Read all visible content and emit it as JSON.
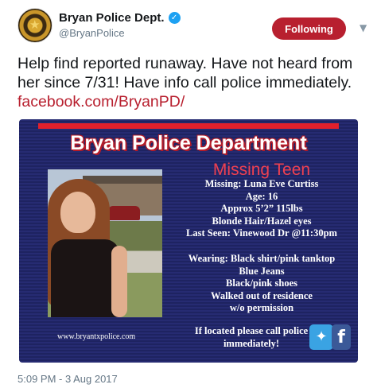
{
  "account": {
    "display_name": "Bryan Police Dept.",
    "handle": "@BryanPolice",
    "verified": true
  },
  "follow_button": {
    "label": "Following"
  },
  "tweet": {
    "text": "Help find reported runaway.  Have not heard from her since 7/31! Have info call police immediately.",
    "link": "facebook.com/BryanPD/",
    "timestamp": "5:09 PM - 3 Aug 2017"
  },
  "flyer": {
    "title": "Bryan Police Department",
    "subtitle": "Missing Teen",
    "details": [
      "Missing: Luna Eve Curtiss",
      "Age: 16",
      "Approx 5’2” 115lbs",
      "Blonde Hair/Hazel eyes",
      "Last Seen: Vinewood Dr  @11:30pm"
    ],
    "wearing": [
      "Wearing:  Black shirt/pink tanktop",
      "Blue Jeans",
      "Black/pink shoes",
      "Walked  out of residence",
      "w/o permission"
    ],
    "call_to_action": [
      "If located please call police",
      "immediately!"
    ],
    "url": "www.bryantxpolice.com"
  },
  "colors": {
    "accent": "#b8202f",
    "verified": "#1da1f2",
    "flyer_background": "#262b72",
    "flyer_title_outline": "#b51c28"
  },
  "icons": [
    "verified-badge-icon",
    "chevron-down-icon",
    "twitter-icon",
    "facebook-icon"
  ]
}
